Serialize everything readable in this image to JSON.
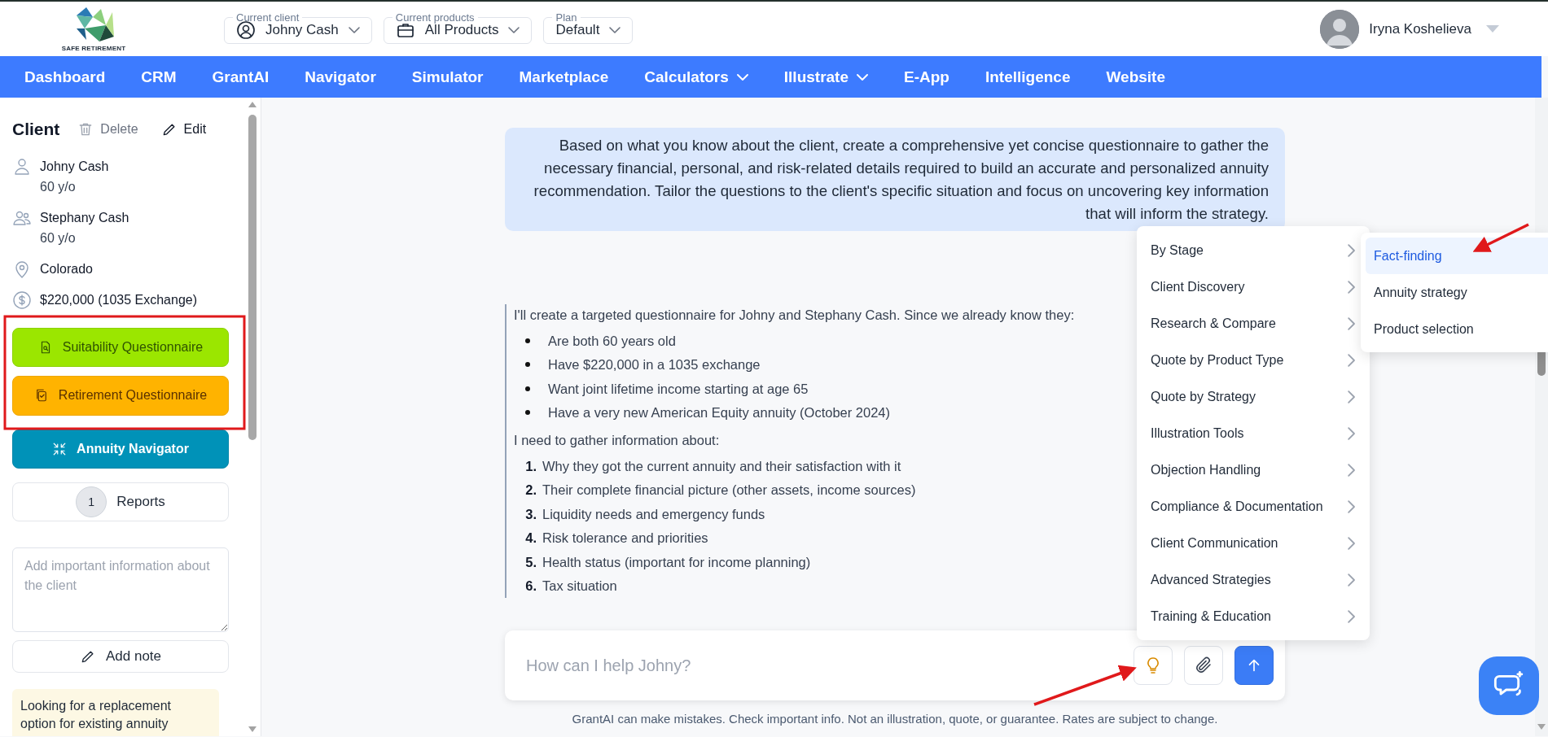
{
  "header": {
    "logo_text": "SAFE RETIREMENT",
    "selectors": [
      {
        "kind": "client",
        "label": "Current client",
        "value": "Johny Cash"
      },
      {
        "kind": "products",
        "label": "Current products",
        "value": "All Products"
      },
      {
        "kind": "plan",
        "label": "Plan",
        "value": "Default"
      }
    ],
    "user": {
      "name": "Iryna Koshelieva"
    }
  },
  "nav": [
    {
      "label": "Dashboard",
      "dropdown": false
    },
    {
      "label": "CRM",
      "dropdown": false
    },
    {
      "label": "GrantAI",
      "dropdown": false
    },
    {
      "label": "Navigator",
      "dropdown": false
    },
    {
      "label": "Simulator",
      "dropdown": false
    },
    {
      "label": "Marketplace",
      "dropdown": false
    },
    {
      "label": "Calculators",
      "dropdown": true
    },
    {
      "label": "Illustrate",
      "dropdown": true
    },
    {
      "label": "E-App",
      "dropdown": false
    },
    {
      "label": "Intelligence",
      "dropdown": false
    },
    {
      "label": "Website",
      "dropdown": false
    }
  ],
  "sidebar": {
    "title": "Client",
    "actions": [
      {
        "kind": "delete",
        "label": "Delete",
        "disabled": true
      },
      {
        "kind": "edit",
        "label": "Edit",
        "disabled": false
      }
    ],
    "facts": [
      {
        "kind": "person",
        "text": "Johny Cash",
        "detail": "60 y/o"
      },
      {
        "kind": "spouse",
        "text": "Stephany Cash",
        "detail": "60 y/o"
      },
      {
        "kind": "location",
        "text": "Colorado"
      },
      {
        "kind": "money",
        "text": "$220,000 (1035 Exchange)"
      }
    ],
    "buttons": [
      {
        "kind": "suitability",
        "label": "Suitability Questionnaire"
      },
      {
        "kind": "retirement",
        "label": "Retirement Questionnaire"
      },
      {
        "kind": "navigator",
        "label": "Annuity Navigator"
      }
    ],
    "reports": {
      "count": "1",
      "label": "Reports"
    },
    "note": {
      "placeholder": "Add important information about the client"
    },
    "add_note": "Add note",
    "tip": "Looking for a replacement option for existing annuity"
  },
  "chat": {
    "request": {
      "text": "Based on what you know about the client, create a comprehensive yet concise questionnaire to gather the necessary financial, personal, and risk-related details required to build an accurate and personalized annuity recommendation. Tailor the questions to the client's specific situation and focus on uncovering key information that will inform the strategy."
    },
    "response": {
      "intro": "I'll create a targeted questionnaire for Johny and Stephany Cash. Since we already know they:",
      "bullets": [
        "Are both 60 years old",
        "Have $220,000 in a 1035 exchange",
        "Want joint lifetime income starting at age 65",
        "Have a very new American Equity annuity (October 2024)"
      ],
      "lead": "I need to gather information about:",
      "steps": [
        {
          "number": "1.",
          "text": "Why they got the current annuity and their satisfaction with it"
        },
        {
          "number": "2.",
          "text": "Their complete financial picture (other assets, income sources)"
        },
        {
          "number": "3.",
          "text": "Liquidity needs and emergency funds"
        },
        {
          "number": "4.",
          "text": "Risk tolerance and priorities"
        },
        {
          "number": "5.",
          "text": "Health status (important for income planning)"
        },
        {
          "number": "6.",
          "text": "Tax situation"
        }
      ]
    },
    "input": {
      "placeholder": "How can I help Johny?"
    },
    "disclaimer": "GrantAI can make mistakes. Check important info. Not an illustration, quote, or guarantee. Rates are subject to change."
  },
  "prompt_menu": {
    "items": [
      {
        "label": "By Stage"
      },
      {
        "label": "Client Discovery"
      },
      {
        "label": "Research & Compare"
      },
      {
        "label": "Quote by Product Type"
      },
      {
        "label": "Quote by Strategy"
      },
      {
        "label": "Illustration Tools"
      },
      {
        "label": "Objection Handling"
      },
      {
        "label": "Compliance & Documentation"
      },
      {
        "label": "Client Communication"
      },
      {
        "label": "Advanced Strategies"
      },
      {
        "label": "Training & Education"
      }
    ],
    "submenu": [
      {
        "label": "Fact-finding",
        "selected": true
      },
      {
        "label": "Annuity strategy",
        "selected": false
      },
      {
        "label": "Product selection",
        "selected": false
      }
    ]
  }
}
